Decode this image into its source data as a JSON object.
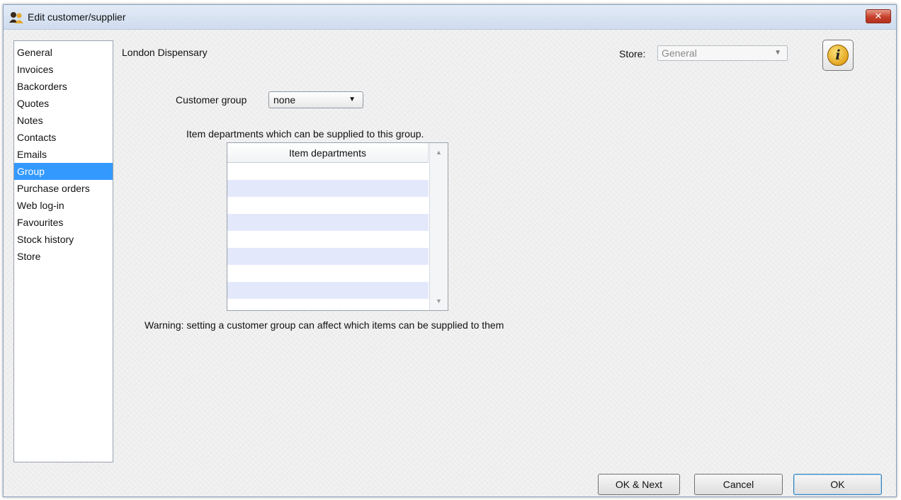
{
  "window": {
    "title": "Edit customer/supplier",
    "close_glyph": "✕"
  },
  "sidebar": {
    "items": [
      {
        "label": "General"
      },
      {
        "label": "Invoices"
      },
      {
        "label": "Backorders"
      },
      {
        "label": "Quotes"
      },
      {
        "label": "Notes"
      },
      {
        "label": "Contacts"
      },
      {
        "label": "Emails"
      },
      {
        "label": "Group",
        "selected": true
      },
      {
        "label": "Purchase orders"
      },
      {
        "label": "Web log-in"
      },
      {
        "label": "Favourites"
      },
      {
        "label": "Stock history"
      },
      {
        "label": "Store"
      }
    ]
  },
  "header": {
    "customer_name": "London Dispensary",
    "store_label": "Store:",
    "store_value": "General",
    "info_icon": "info-icon"
  },
  "group": {
    "label": "Customer group",
    "value": "none",
    "departments_caption": "Item departments which can be supplied to this group.",
    "table": {
      "column": "Item departments",
      "rows": []
    },
    "warning": "Warning: setting a customer group can affect which items can be supplied to them"
  },
  "buttons": {
    "ok_next": "OK & Next",
    "cancel": "Cancel",
    "ok": "OK"
  },
  "colors": {
    "selection": "#3399ff",
    "row_alt": "#e4e8fb",
    "close": "#c6402a"
  }
}
